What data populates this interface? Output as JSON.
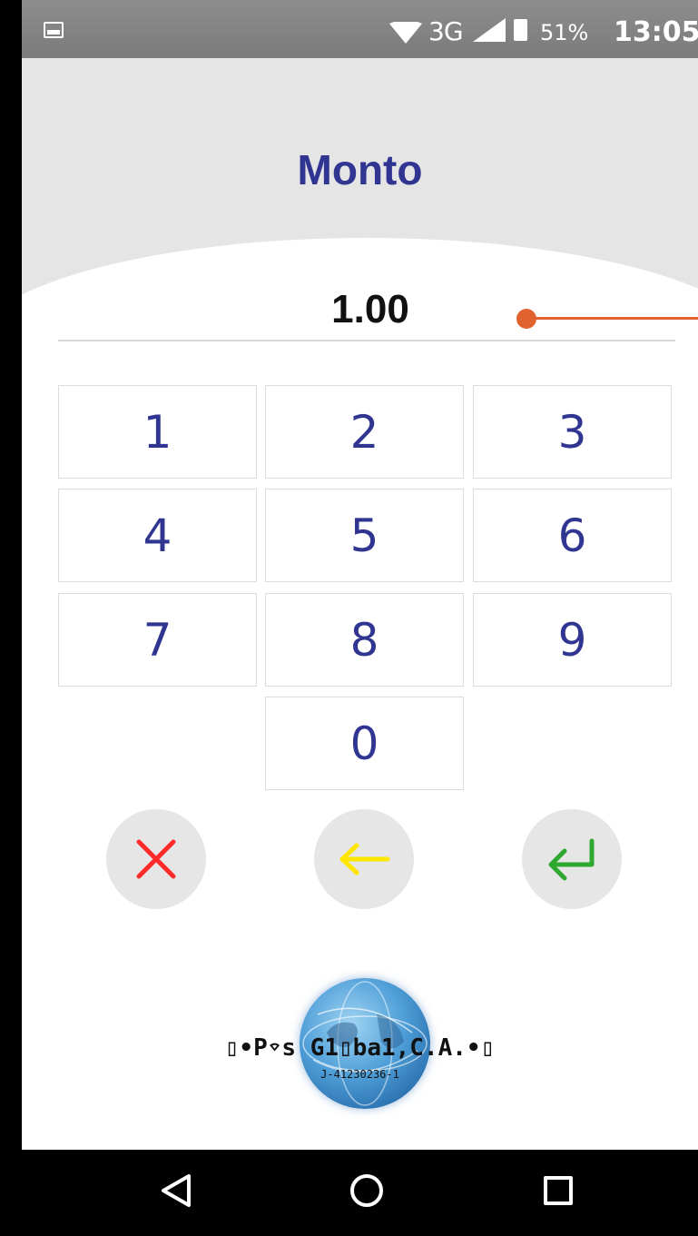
{
  "status_bar": {
    "network": "3G",
    "battery": "51%",
    "time": "13:05",
    "icons": [
      "gallery-icon",
      "wifi-icon",
      "signal-icon",
      "battery-icon"
    ]
  },
  "header": {
    "title": "Monto"
  },
  "amount": {
    "value": "1.00"
  },
  "keypad": {
    "keys": [
      "1",
      "2",
      "3",
      "4",
      "5",
      "6",
      "7",
      "8",
      "9",
      "0"
    ]
  },
  "actions": {
    "cancel_icon": "close-icon",
    "backspace_icon": "arrow-left-icon",
    "enter_icon": "enter-icon",
    "colors": {
      "cancel": "#ff2a2a",
      "backspace": "#ffe600",
      "enter": "#2ea82e"
    }
  },
  "logo": {
    "text": "▯•P⌔s G1▯ba1,C.A.•▯",
    "rif": "J-41230236-1"
  },
  "nav_bar": {
    "icons": [
      "back-icon",
      "home-icon",
      "recents-icon"
    ]
  },
  "colors": {
    "accent": "#2f3590",
    "cursor": "#e2622f",
    "header_bg": "#e5e5e5"
  }
}
